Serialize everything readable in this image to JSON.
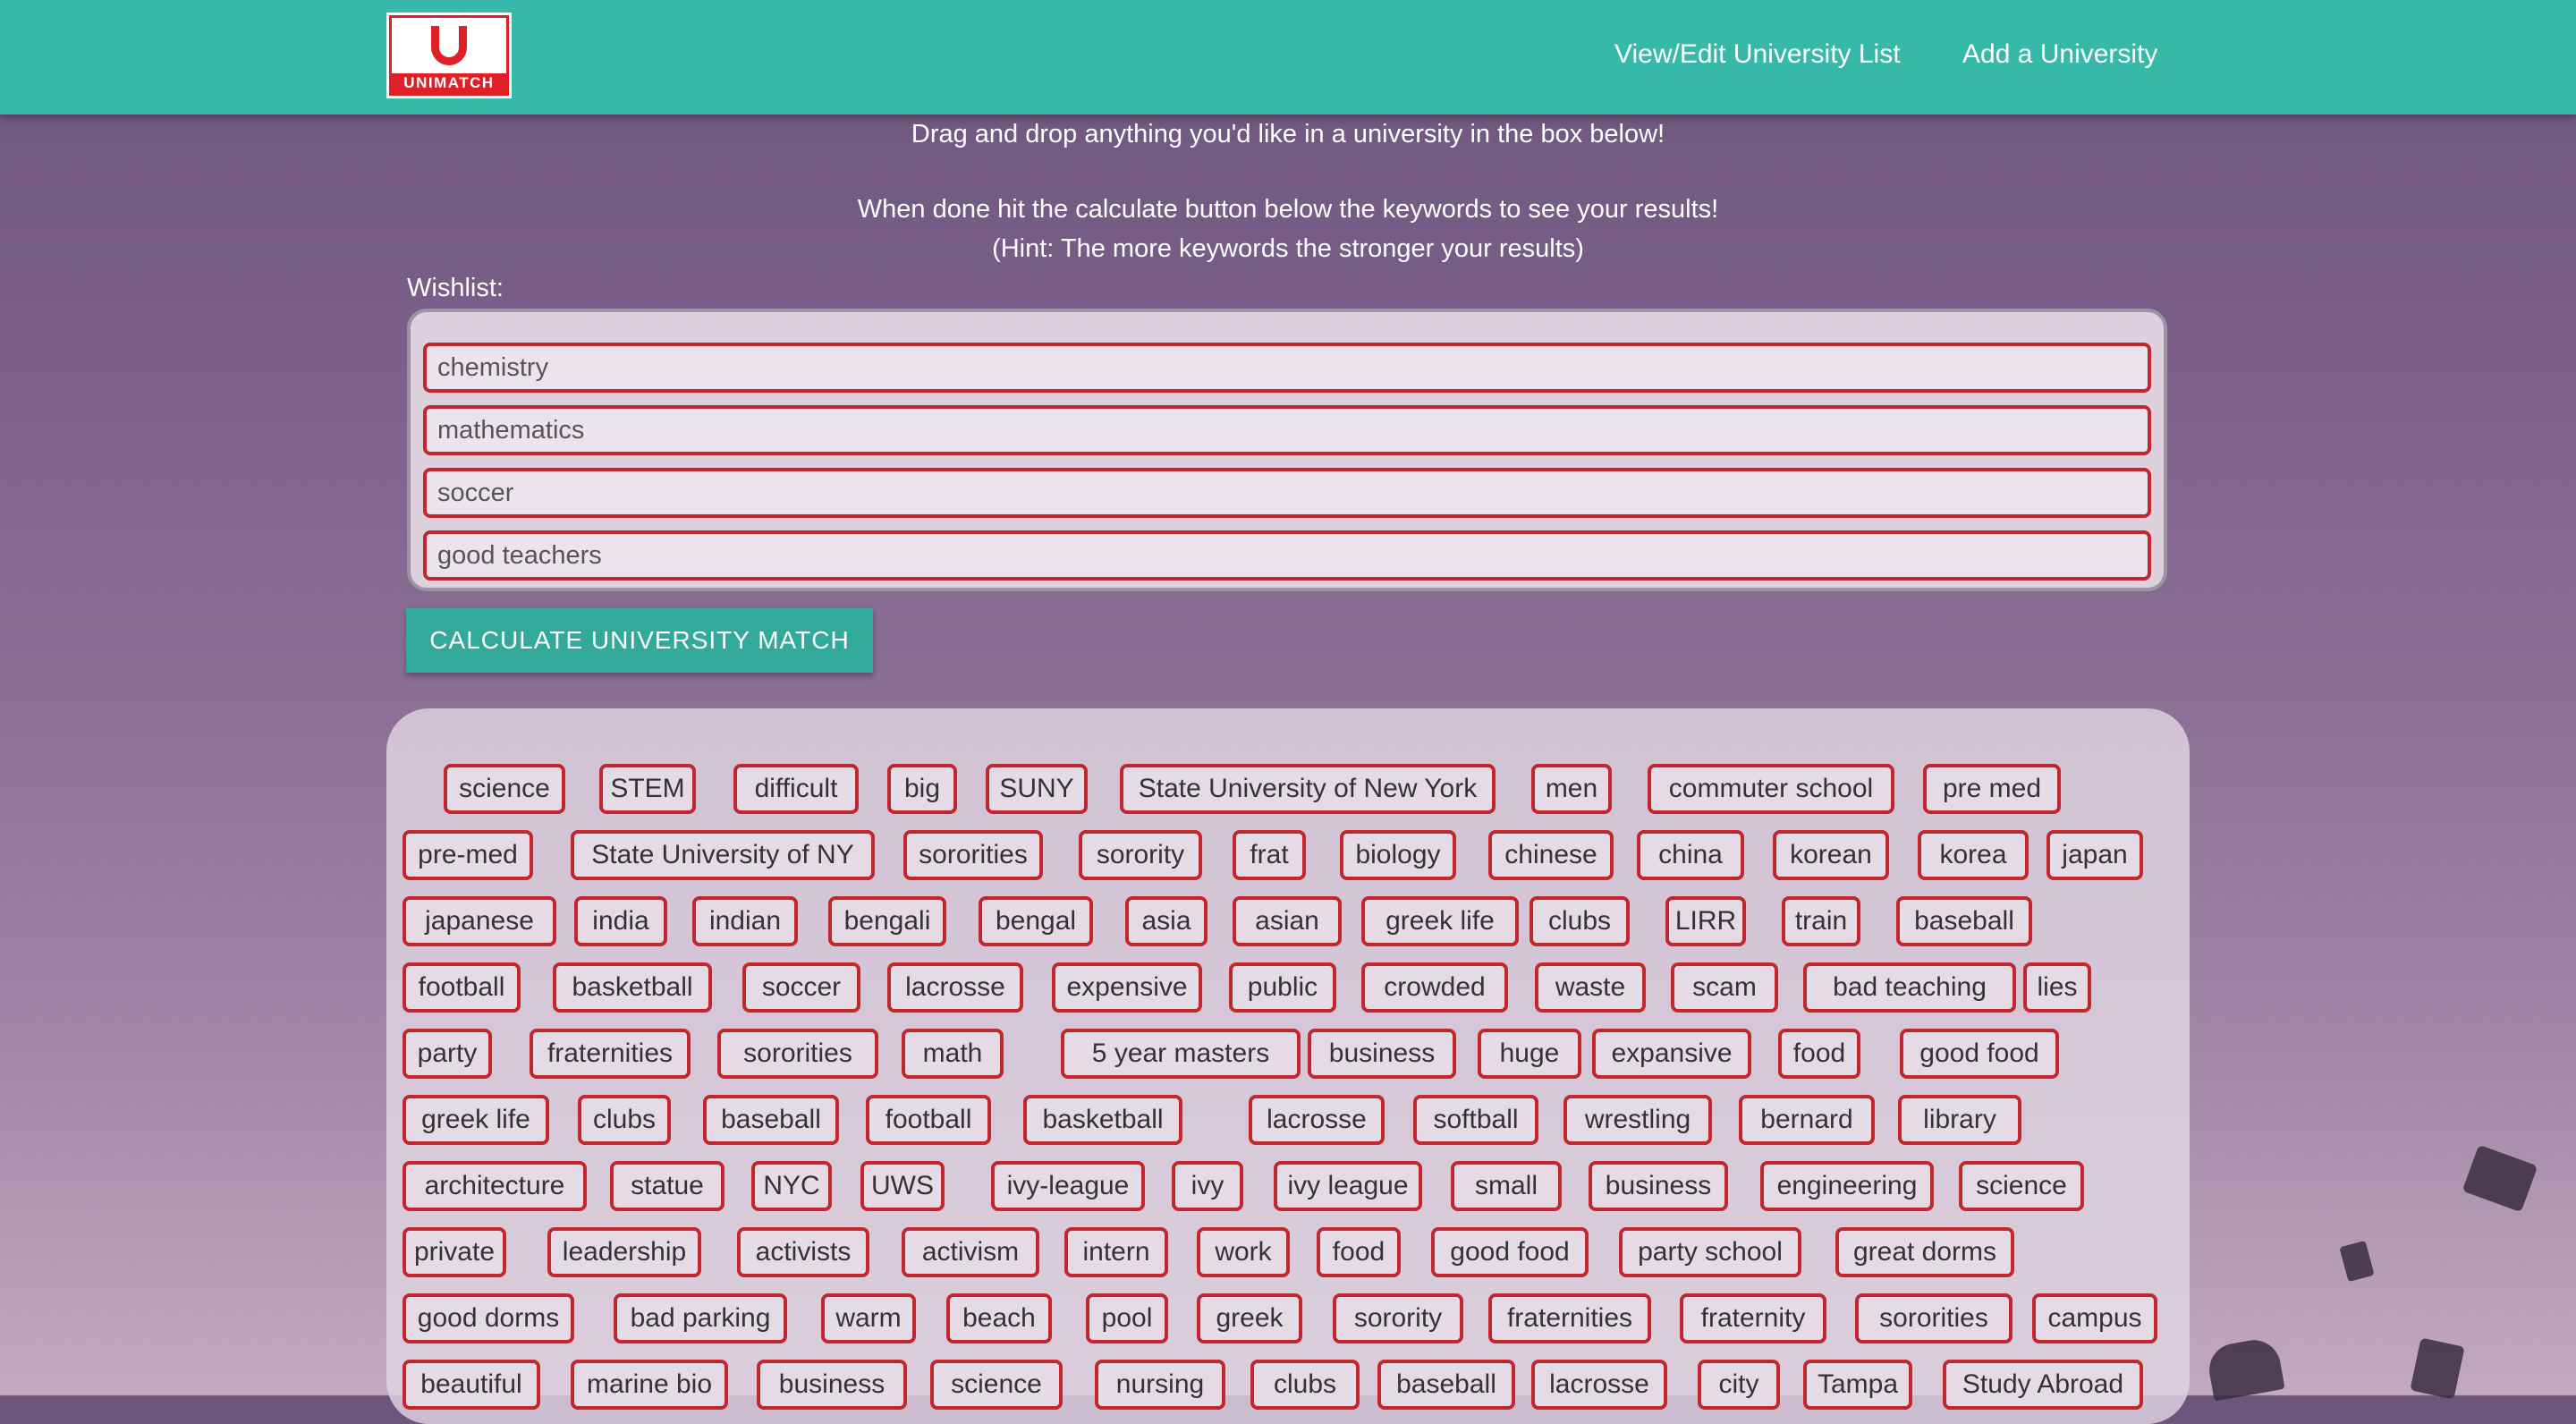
{
  "header": {
    "logo_text": "UNIMATCH",
    "nav": [
      "View/Edit University List",
      "Add a University"
    ],
    "accent_color": "#37b9aa",
    "brand_color": "#e02027"
  },
  "instructions": {
    "line1": "Drag and drop anything you'd like in a university in the box below!",
    "line2": "When done hit the calculate button below the keywords to see your results!",
    "line3": "(Hint: The more keywords the stronger your results)"
  },
  "wishlist": {
    "label": "Wishlist:",
    "items": [
      "chemistry",
      "mathematics",
      "soccer",
      "good teachers"
    ]
  },
  "calculate_button": "CALCULATE UNIVERSITY MATCH",
  "keyword_rows": [
    [
      "science",
      "STEM",
      "difficult",
      "big",
      "SUNY",
      "State University of New York",
      "men",
      "commuter school",
      "pre med"
    ],
    [
      "pre-med",
      "State University of NY",
      "sororities",
      "sorority",
      "frat",
      "biology",
      "chinese",
      "china",
      "korean",
      "korea",
      "japan"
    ],
    [
      "japanese",
      "india",
      "indian",
      "bengali",
      "bengal",
      "asia",
      "asian",
      "greek life",
      "clubs",
      "LIRR",
      "train",
      "baseball"
    ],
    [
      "football",
      "basketball",
      "soccer",
      "lacrosse",
      "expensive",
      "public",
      "crowded",
      "waste",
      "scam",
      "bad teaching",
      "lies"
    ],
    [
      "party",
      "fraternities",
      "sororities",
      "math",
      "5 year masters",
      "business",
      "huge",
      "expansive",
      "food",
      "good food"
    ],
    [
      "greek life",
      "clubs",
      "baseball",
      "football",
      "basketball",
      "lacrosse",
      "softball",
      "wrestling",
      "bernard",
      "library"
    ],
    [
      "architecture",
      "statue",
      "NYC",
      "UWS",
      "ivy-league",
      "ivy",
      "ivy league",
      "small",
      "business",
      "engineering",
      "science"
    ],
    [
      "private",
      "leadership",
      "activists",
      "activism",
      "intern",
      "work",
      "food",
      "good food",
      "party school",
      "great dorms"
    ],
    [
      "good dorms",
      "bad parking",
      "warm",
      "beach",
      "pool",
      "greek",
      "sorority",
      "fraternities",
      "fraternity",
      "sororities",
      "campus"
    ],
    [
      "beautiful",
      "marine bio",
      "business",
      "science",
      "nursing",
      "clubs",
      "baseball",
      "lacrosse",
      "city",
      "Tampa",
      "Study Abroad"
    ]
  ]
}
